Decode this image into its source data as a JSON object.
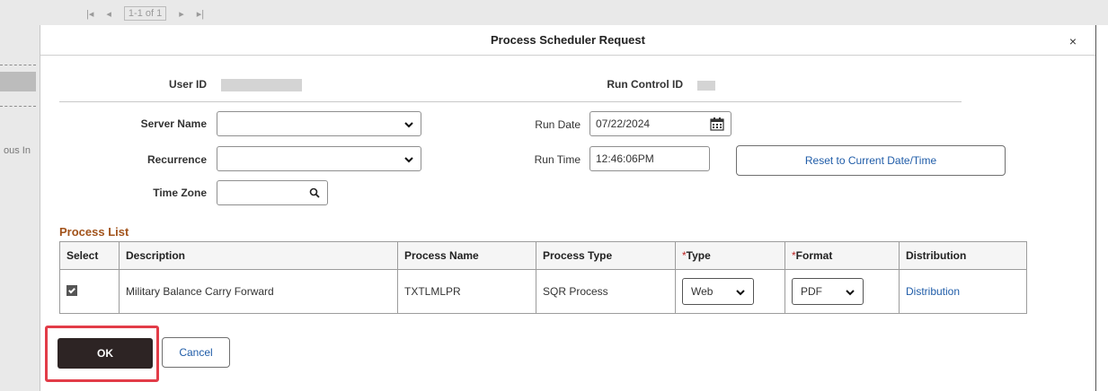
{
  "background": {
    "pager_text": "1-1 of 1",
    "partial_label": "ous In"
  },
  "modal": {
    "title": "Process Scheduler Request",
    "close_symbol": "×"
  },
  "header": {
    "user_id_label": "User ID",
    "run_control_id_label": "Run Control ID"
  },
  "form": {
    "server_name_label": "Server Name",
    "server_name_value": "",
    "recurrence_label": "Recurrence",
    "recurrence_value": "",
    "time_zone_label": "Time Zone",
    "time_zone_value": "",
    "run_date_label": "Run Date",
    "run_date_value": "07/22/2024",
    "run_time_label": "Run Time",
    "run_time_value": "12:46:06PM",
    "reset_button_label": "Reset to Current Date/Time"
  },
  "process_list": {
    "title": "Process List",
    "columns": [
      "Select",
      "Description",
      "Process Name",
      "Process Type",
      "Type",
      "Format",
      "Distribution"
    ],
    "required_marker": "*",
    "rows": [
      {
        "selected": true,
        "description": "Military Balance Carry Forward",
        "process_name": "TXTLMLPR",
        "process_type": "SQR Process",
        "type": "Web",
        "format": "PDF",
        "distribution": "Distribution"
      }
    ]
  },
  "footer": {
    "ok_label": "OK",
    "cancel_label": "Cancel"
  },
  "colors": {
    "section_title": "#a2531b",
    "link": "#1f5ca8",
    "ok_button": "#2d2424",
    "highlight": "#e23c48"
  },
  "icons": [
    "chevron-down-icon",
    "calendar-icon",
    "search-icon",
    "close-icon",
    "checkbox-checked-icon"
  ]
}
